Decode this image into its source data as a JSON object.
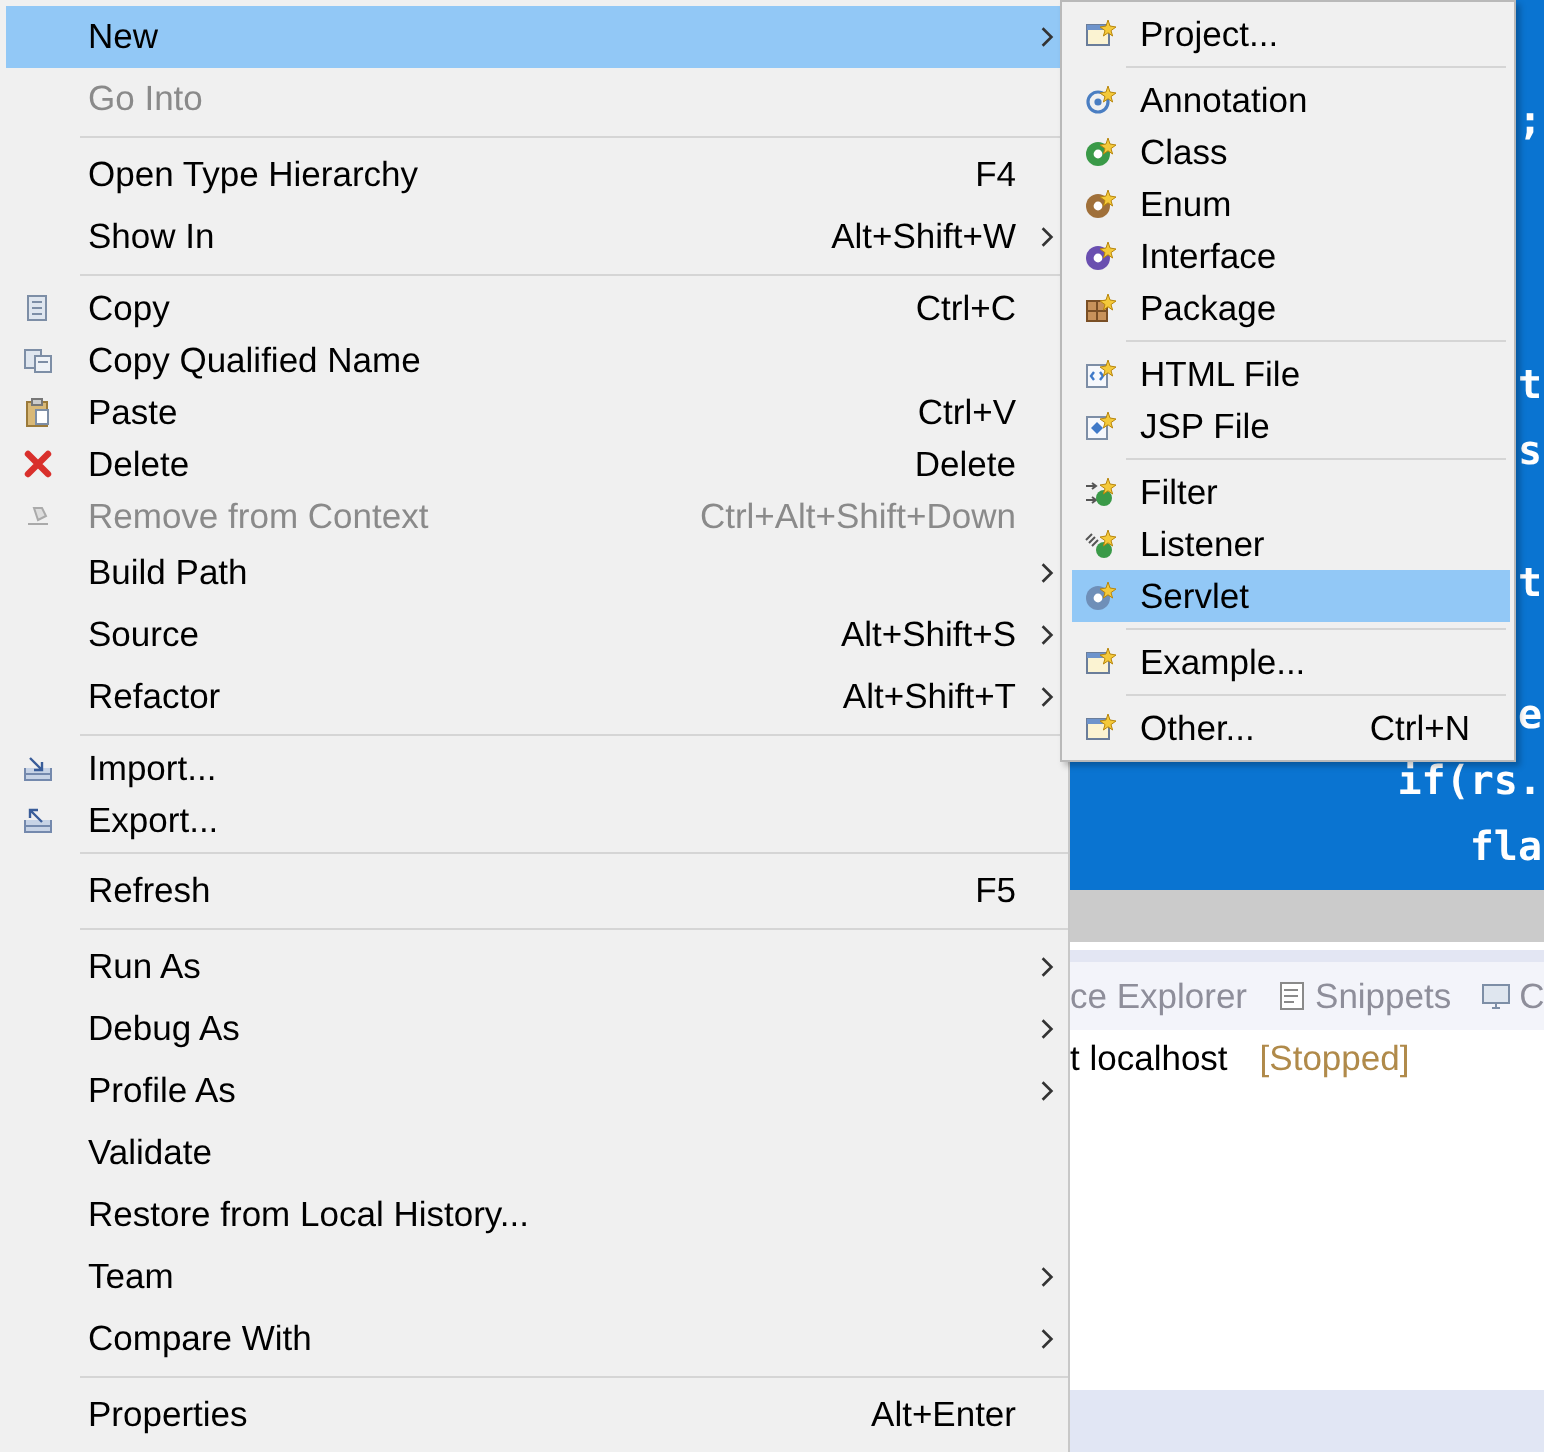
{
  "editor": {
    "lines": [
      ";",
      "t",
      "s",
      "t",
      "e",
      "if(rs.",
      "fla"
    ]
  },
  "bottom_panel": {
    "tabs": [
      {
        "label": "ce Explorer",
        "selected": false
      },
      {
        "label": "Snippets",
        "selected": false
      },
      {
        "label": "C",
        "selected": false
      }
    ],
    "server": {
      "name": "t localhost",
      "status": "[Stopped]"
    }
  },
  "context_menu": {
    "items": [
      {
        "kind": "item",
        "label": "New",
        "submenu": true,
        "selected": true,
        "disabled": false
      },
      {
        "kind": "item",
        "label": "Go Into",
        "submenu": false,
        "selected": false,
        "disabled": true
      },
      {
        "kind": "separator"
      },
      {
        "kind": "item",
        "label": "Open Type Hierarchy",
        "shortcut": "F4",
        "submenu": false,
        "selected": false,
        "disabled": false
      },
      {
        "kind": "item",
        "label": "Show In",
        "shortcut": "Alt+Shift+W",
        "submenu": true,
        "selected": false,
        "disabled": false
      },
      {
        "kind": "separator"
      },
      {
        "kind": "item",
        "label": "Copy",
        "shortcut": "Ctrl+C",
        "submenu": false,
        "selected": false,
        "disabled": false
      },
      {
        "kind": "item",
        "label": "Copy Qualified Name",
        "submenu": false,
        "selected": false,
        "disabled": false
      },
      {
        "kind": "item",
        "label": "Paste",
        "shortcut": "Ctrl+V",
        "submenu": false,
        "selected": false,
        "disabled": false
      },
      {
        "kind": "item",
        "label": "Delete",
        "shortcut": "Delete",
        "submenu": false,
        "selected": false,
        "disabled": false
      },
      {
        "kind": "item",
        "label": "Remove from Context",
        "shortcut": "Ctrl+Alt+Shift+Down",
        "submenu": false,
        "selected": false,
        "disabled": true
      },
      {
        "kind": "item",
        "label": "Build Path",
        "submenu": true,
        "selected": false,
        "disabled": false
      },
      {
        "kind": "item",
        "label": "Source",
        "shortcut": "Alt+Shift+S",
        "submenu": true,
        "selected": false,
        "disabled": false
      },
      {
        "kind": "item",
        "label": "Refactor",
        "shortcut": "Alt+Shift+T",
        "submenu": true,
        "selected": false,
        "disabled": false
      },
      {
        "kind": "separator"
      },
      {
        "kind": "item",
        "label": "Import...",
        "submenu": false,
        "selected": false,
        "disabled": false
      },
      {
        "kind": "item",
        "label": "Export...",
        "submenu": false,
        "selected": false,
        "disabled": false
      },
      {
        "kind": "separator"
      },
      {
        "kind": "item",
        "label": "Refresh",
        "shortcut": "F5",
        "submenu": false,
        "selected": false,
        "disabled": false
      },
      {
        "kind": "separator"
      },
      {
        "kind": "item",
        "label": "Run As",
        "submenu": true,
        "selected": false,
        "disabled": false
      },
      {
        "kind": "item",
        "label": "Debug As",
        "submenu": true,
        "selected": false,
        "disabled": false
      },
      {
        "kind": "item",
        "label": "Profile As",
        "submenu": true,
        "selected": false,
        "disabled": false
      },
      {
        "kind": "item",
        "label": "Validate",
        "submenu": false,
        "selected": false,
        "disabled": false
      },
      {
        "kind": "item",
        "label": "Restore from Local History...",
        "submenu": false,
        "selected": false,
        "disabled": false
      },
      {
        "kind": "item",
        "label": "Team",
        "submenu": true,
        "selected": false,
        "disabled": false
      },
      {
        "kind": "item",
        "label": "Compare With",
        "submenu": true,
        "selected": false,
        "disabled": false
      },
      {
        "kind": "separator"
      },
      {
        "kind": "item",
        "label": "Properties",
        "shortcut": "Alt+Enter",
        "submenu": false,
        "selected": false,
        "disabled": false
      }
    ]
  },
  "new_submenu": {
    "items": [
      {
        "kind": "item",
        "label": "Project...",
        "selected": false
      },
      {
        "kind": "separator"
      },
      {
        "kind": "item",
        "label": "Annotation",
        "selected": false
      },
      {
        "kind": "item",
        "label": "Class",
        "selected": false
      },
      {
        "kind": "item",
        "label": "Enum",
        "selected": false
      },
      {
        "kind": "item",
        "label": "Interface",
        "selected": false
      },
      {
        "kind": "item",
        "label": "Package",
        "selected": false
      },
      {
        "kind": "separator"
      },
      {
        "kind": "item",
        "label": "HTML File",
        "selected": false
      },
      {
        "kind": "item",
        "label": "JSP File",
        "selected": false
      },
      {
        "kind": "separator"
      },
      {
        "kind": "item",
        "label": "Filter",
        "selected": false
      },
      {
        "kind": "item",
        "label": "Listener",
        "selected": false
      },
      {
        "kind": "item",
        "label": "Servlet",
        "selected": true
      },
      {
        "kind": "separator"
      },
      {
        "kind": "item",
        "label": "Example...",
        "selected": false
      },
      {
        "kind": "separator"
      },
      {
        "kind": "item",
        "label": "Other...",
        "shortcut": "Ctrl+N",
        "selected": false
      }
    ]
  }
}
